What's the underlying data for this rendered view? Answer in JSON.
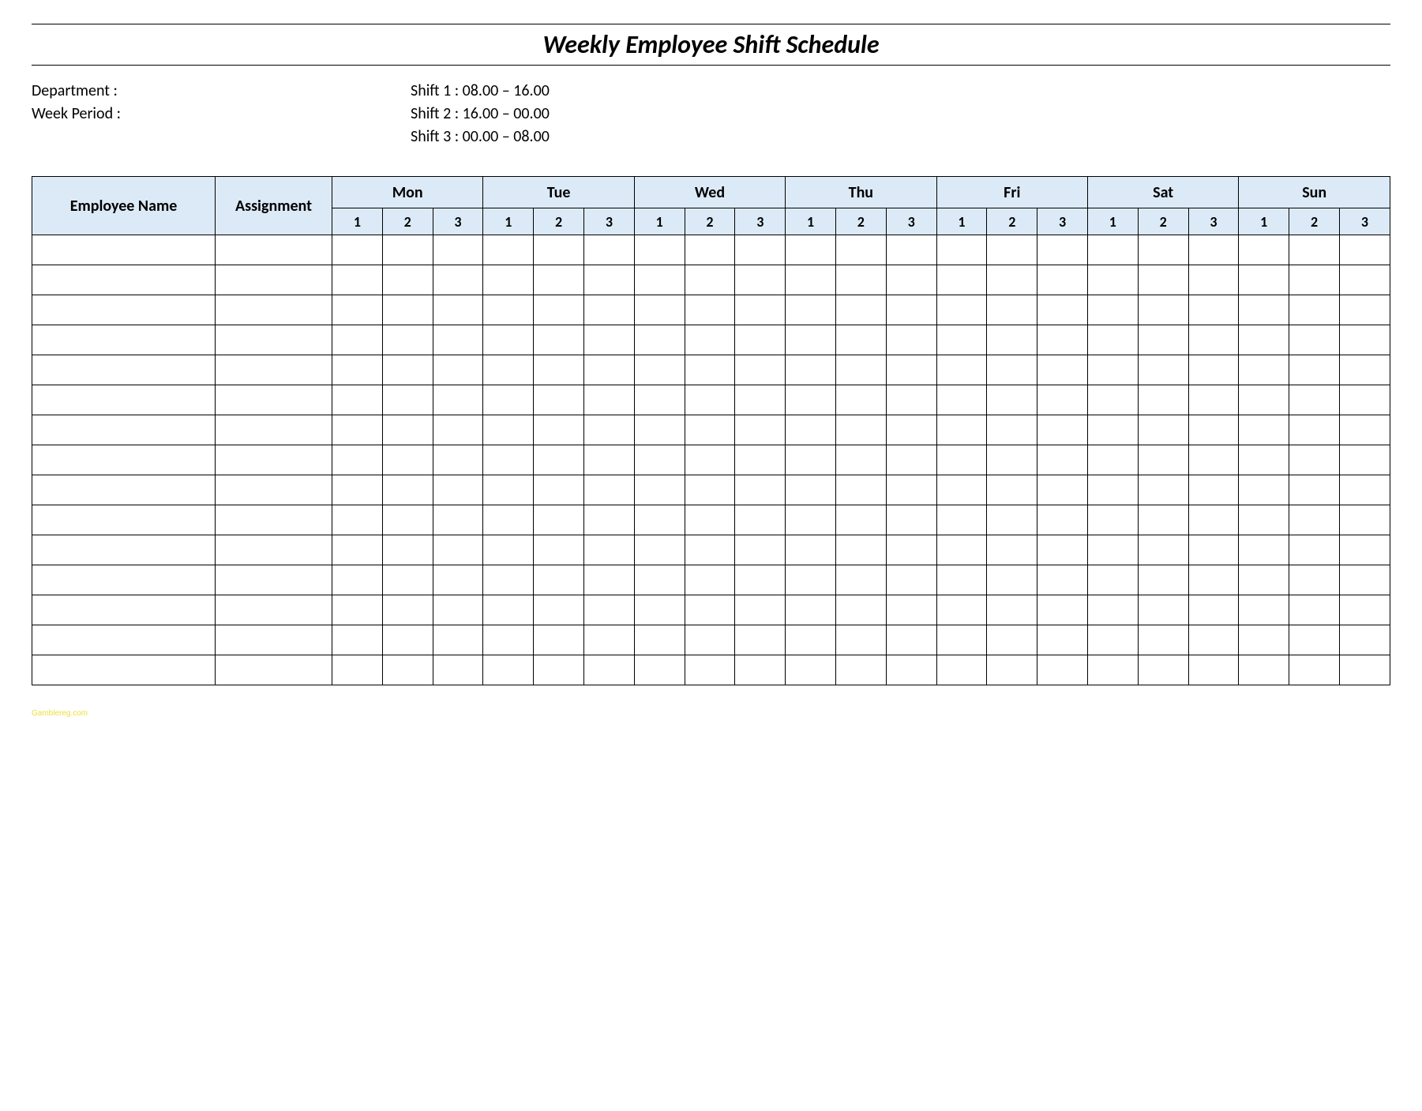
{
  "title": "Weekly Employee Shift Schedule",
  "meta": {
    "department_label": "Department    :",
    "week_period_label": "Week  Period :",
    "shift1": "Shift 1  : 08.00  – 16.00",
    "shift2": "Shift 2  : 16.00  – 00.00",
    "shift3": "Shift 3  : 00.00  – 08.00"
  },
  "headers": {
    "employee_name": "Employee Name",
    "assignment": "Assignment",
    "days": [
      "Mon",
      "Tue",
      "Wed",
      "Thu",
      "Fri",
      "Sat",
      "Sun"
    ],
    "shifts": [
      "1",
      "2",
      "3"
    ]
  },
  "rows": 15,
  "footer": "Gamblereg.com"
}
